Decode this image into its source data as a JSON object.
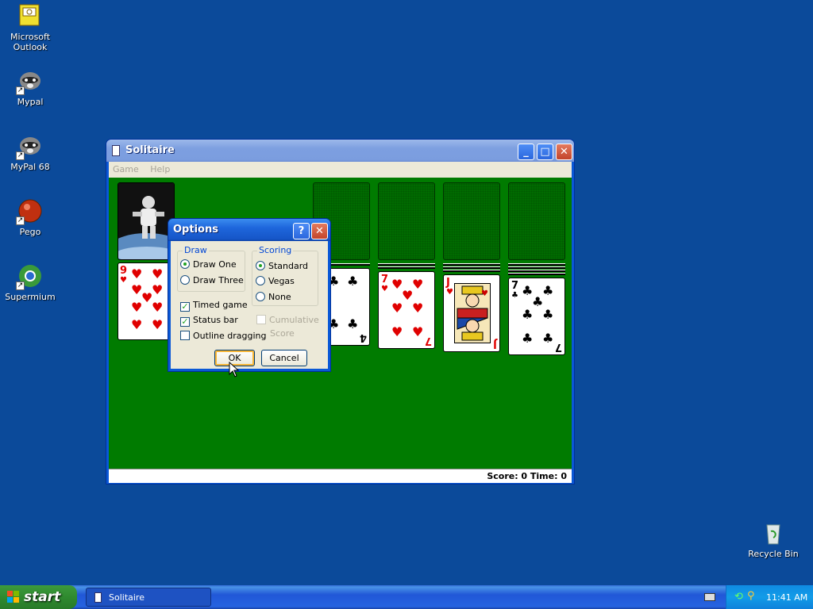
{
  "desktop": {
    "icons": [
      {
        "label": "Microsoft Outlook"
      },
      {
        "label": "Mypal"
      },
      {
        "label": "MyPal 68"
      },
      {
        "label": "Pego"
      },
      {
        "label": "Supermium"
      },
      {
        "label": "Recycle Bin"
      }
    ]
  },
  "window": {
    "title": "Solitaire",
    "menu": [
      "Game",
      "Help"
    ],
    "status": "Score: 0 Time: 0"
  },
  "cards": {
    "waste_rank": "9",
    "tableau": [
      {
        "rank": "4",
        "suit": "clubs",
        "color": "black"
      },
      {
        "rank": "7",
        "suit": "hearts",
        "color": "red"
      },
      {
        "rank": "J",
        "suit": "hearts",
        "color": "red"
      },
      {
        "rank": "7",
        "suit": "clubs",
        "color": "black"
      }
    ]
  },
  "dialog": {
    "title": "Options",
    "help_btn": "?",
    "close_btn": "✕",
    "draw_group": "Draw",
    "draw_one": "Draw One",
    "draw_three": "Draw Three",
    "scoring_group": "Scoring",
    "standard": "Standard",
    "vegas": "Vegas",
    "none": "None",
    "timed_game": "Timed game",
    "status_bar": "Status bar",
    "outline_dragging": "Outline dragging",
    "cumulative": "Cumulative",
    "score": "Score",
    "ok": "OK",
    "cancel": "Cancel"
  },
  "taskbar": {
    "start": "start",
    "task_label": "Solitaire",
    "clock": "11:41 AM"
  },
  "colors": {
    "desktop": "#0b4a9a",
    "felt": "#007b00",
    "accent": "#0046d5"
  }
}
